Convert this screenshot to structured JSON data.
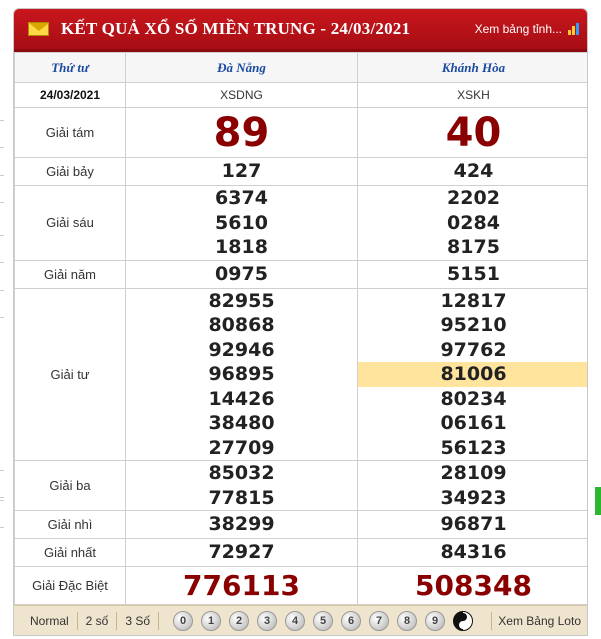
{
  "header": {
    "title": "KẾT QUẢ XỔ SỐ MIỀN TRUNG - 24/03/2021",
    "view_more": "Xem bảng tỉnh..."
  },
  "table": {
    "weekday": "Thứ tư",
    "provinces": [
      "Đà Nẵng",
      "Khánh Hòa"
    ],
    "date": "24/03/2021",
    "codes": [
      "XSDNG",
      "XSKH"
    ],
    "prizes": [
      {
        "label": "Giải tám",
        "values": [
          [
            "89"
          ],
          [
            "40"
          ]
        ]
      },
      {
        "label": "Giải bảy",
        "values": [
          [
            "127"
          ],
          [
            "424"
          ]
        ]
      },
      {
        "label": "Giải sáu",
        "values": [
          [
            "6374",
            "5610",
            "1818"
          ],
          [
            "2202",
            "0284",
            "8175"
          ]
        ]
      },
      {
        "label": "Giải năm",
        "values": [
          [
            "0975"
          ],
          [
            "5151"
          ]
        ]
      },
      {
        "label": "Giải tư",
        "values": [
          [
            "82955",
            "80868",
            "92946",
            "96895",
            "14426",
            "38480",
            "27709"
          ],
          [
            "12817",
            "95210",
            "97762",
            "81006",
            "80234",
            "06161",
            "56123"
          ]
        ]
      },
      {
        "label": "Giải ba",
        "values": [
          [
            "85032",
            "77815"
          ],
          [
            "28109",
            "34923"
          ]
        ]
      },
      {
        "label": "Giải nhì",
        "values": [
          [
            "38299"
          ],
          [
            "96871"
          ]
        ]
      },
      {
        "label": "Giải nhất",
        "values": [
          [
            "72927"
          ],
          [
            "84316"
          ]
        ]
      },
      {
        "label": "Giải Đặc Biệt",
        "values": [
          [
            "776113"
          ],
          [
            "508348"
          ]
        ]
      }
    ],
    "highlighted": "81006"
  },
  "footer": {
    "tabs": [
      "Normal",
      "2 số",
      "3 Số"
    ],
    "digits": [
      "0",
      "1",
      "2",
      "3",
      "4",
      "5",
      "6",
      "7",
      "8",
      "9"
    ],
    "loto_label": "Xem Bảng Loto"
  },
  "colors": {
    "header_red": "#c9161d",
    "prize_red": "#8a0000",
    "province_blue": "#1a4ba0",
    "highlight": "#ffe49e"
  }
}
